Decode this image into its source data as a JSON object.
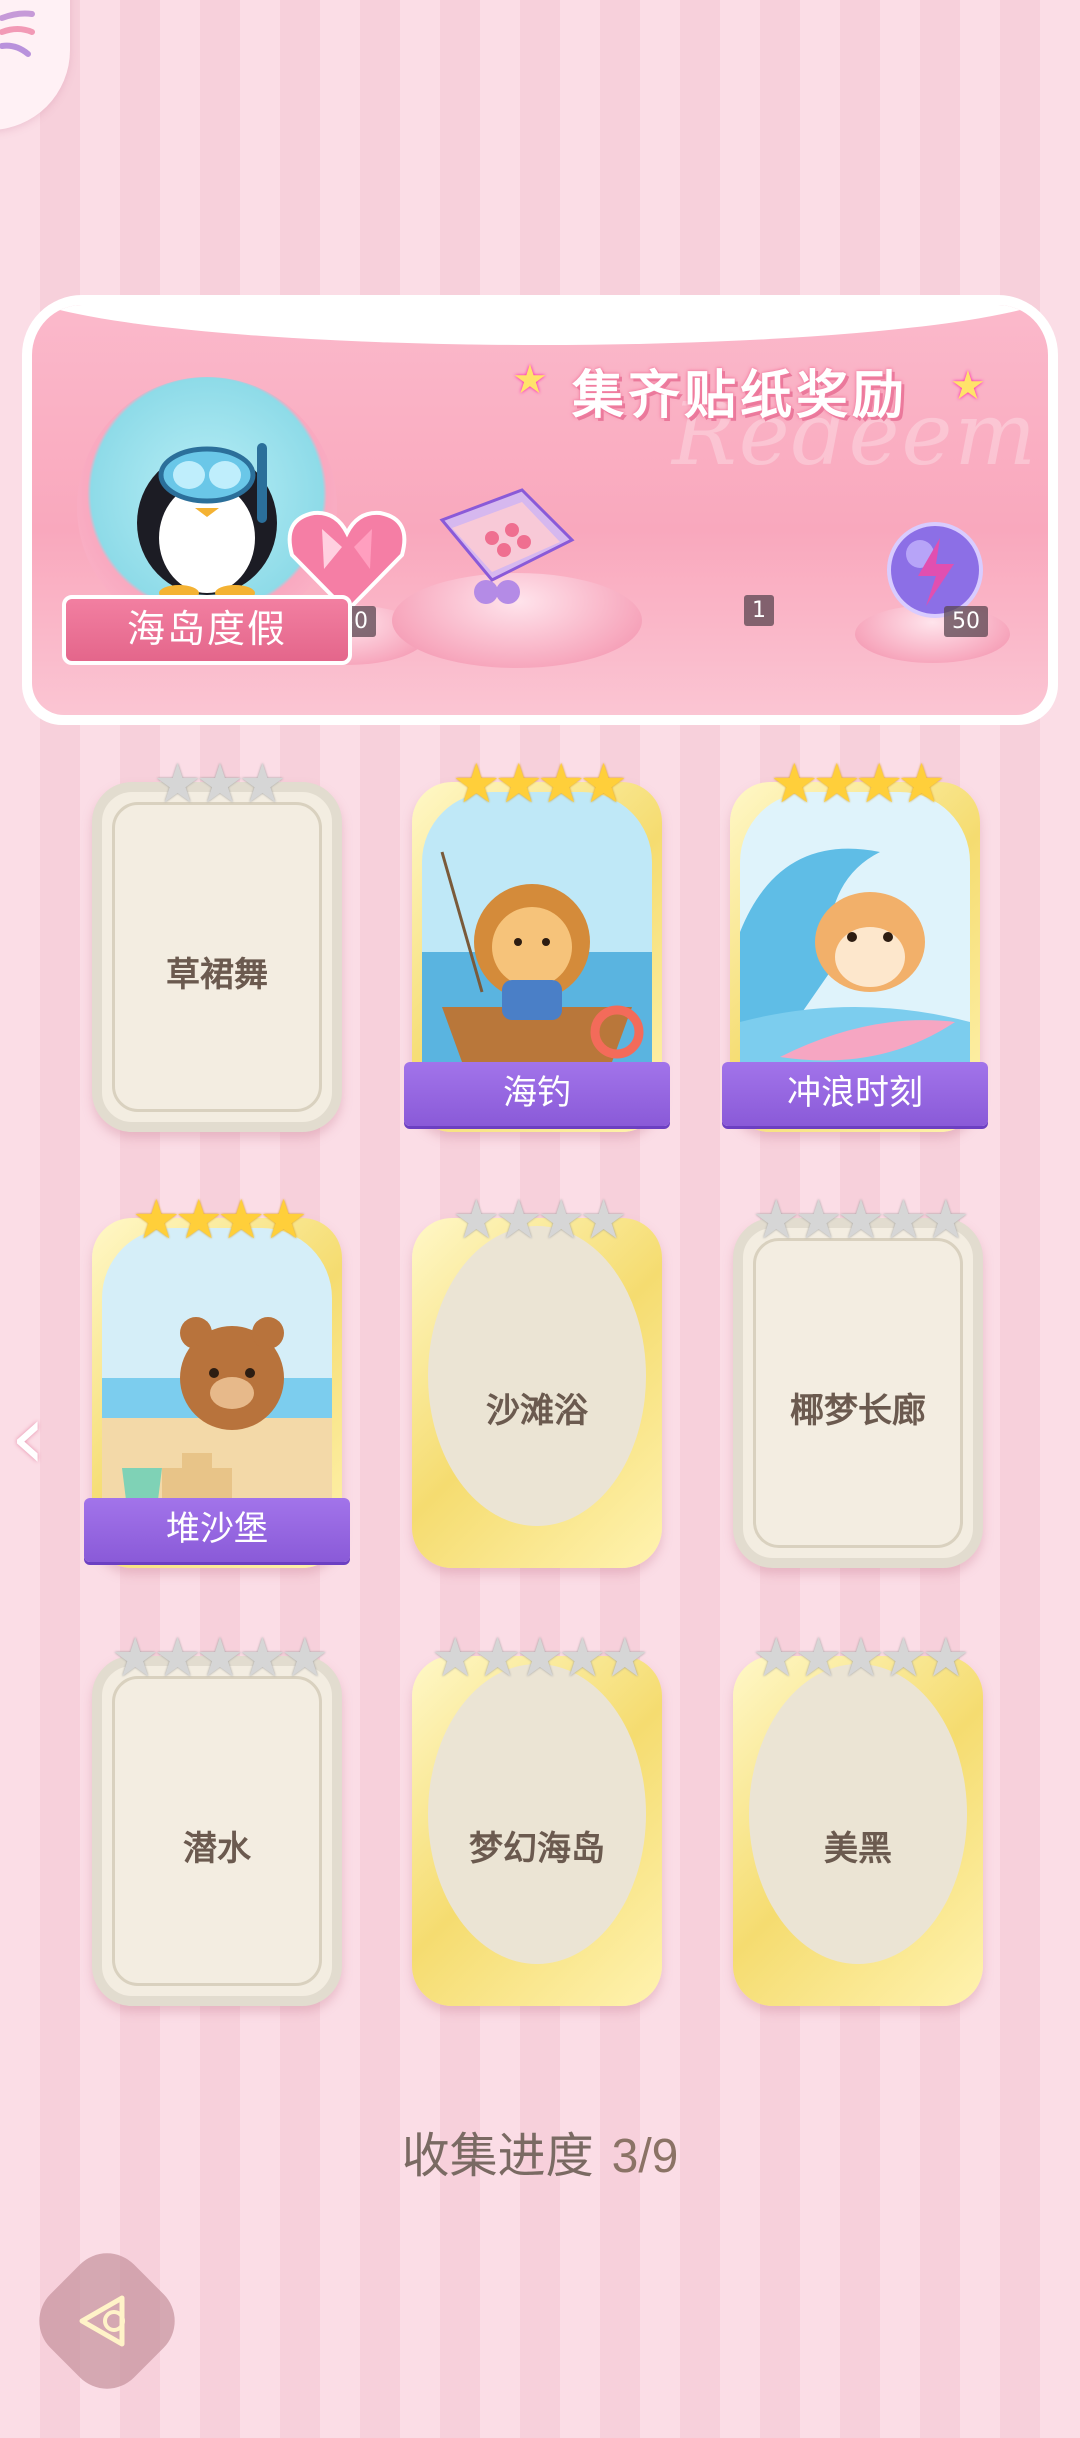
{
  "banner": {
    "badge_label": "海岛度假",
    "title": "集齐贴纸奖励",
    "watermark": "Redeem",
    "rewards": [
      {
        "icon": "pink-heart-gem-icon",
        "count": "50"
      },
      {
        "icon": "sticker-box-icon",
        "count": "1"
      },
      {
        "icon": "purple-lightning-orb-icon",
        "count": "50"
      }
    ]
  },
  "cards": [
    {
      "name": "草裙舞",
      "collected": false,
      "stars": 3,
      "frame": "silver"
    },
    {
      "name": "海钓",
      "collected": true,
      "stars": 4,
      "frame": "gold"
    },
    {
      "name": "冲浪时刻",
      "collected": true,
      "stars": 4,
      "frame": "gold"
    },
    {
      "name": "堆沙堡",
      "collected": true,
      "stars": 4,
      "frame": "gold"
    },
    {
      "name": "沙滩浴",
      "collected": false,
      "stars": 4,
      "frame": "gold"
    },
    {
      "name": "椰梦长廊",
      "collected": false,
      "stars": 5,
      "frame": "silver"
    },
    {
      "name": "潜水",
      "collected": false,
      "stars": 5,
      "frame": "silver"
    },
    {
      "name": "梦幻海岛",
      "collected": false,
      "stars": 5,
      "frame": "gold"
    },
    {
      "name": "美黑",
      "collected": false,
      "stars": 5,
      "frame": "gold"
    }
  ],
  "progress": {
    "label": "收集进度",
    "value": "3/9"
  },
  "colors": {
    "accent_pink": "#f27fa1",
    "ribbon_purple": "#8a5ad8",
    "star_gold": "#ffcf3a"
  }
}
